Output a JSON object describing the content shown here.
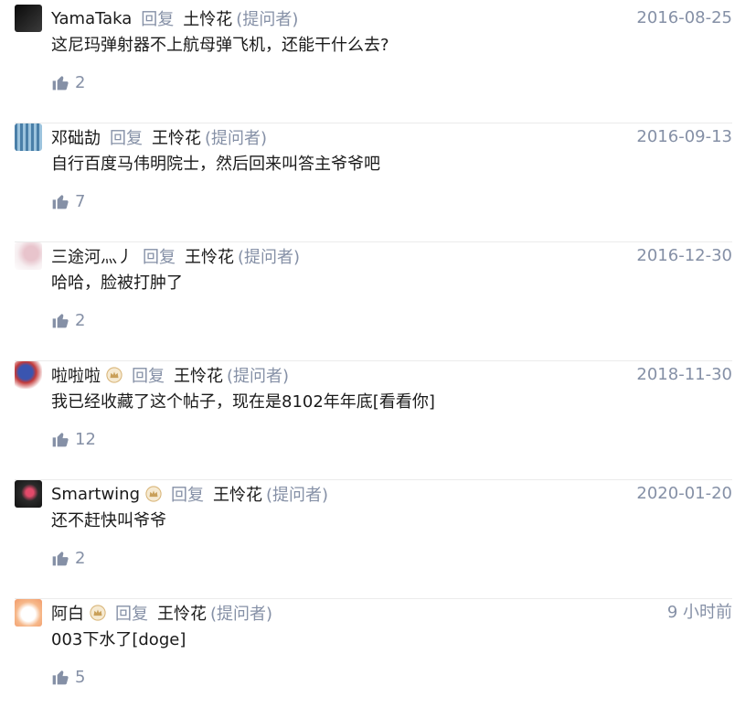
{
  "reply_label": "回复",
  "asker_label": "(提问者)",
  "icons": {
    "like": "thumbs-up-icon",
    "badge": "crown-badge-icon"
  },
  "comments": [
    {
      "username": "YamaTaka",
      "target": "土怜花",
      "date": "2016-08-25",
      "content": "这尼玛弹射器不上航母弹飞机，还能干什么去?",
      "likes": "2",
      "badge": false
    },
    {
      "username": "邓础劼",
      "target": "王怜花",
      "date": "2016-09-13",
      "content": "自行百度马伟明院士，然后回来叫答主爷爷吧",
      "likes": "7",
      "badge": false
    },
    {
      "username": "三途河灬丿",
      "target": "王怜花",
      "date": "2016-12-30",
      "content": "哈哈，脸被打肿了",
      "likes": "2",
      "badge": false
    },
    {
      "username": "啦啦啦",
      "target": "王怜花",
      "date": "2018-11-30",
      "content": "我已经收藏了这个帖子，现在是8102年年底[看看你]",
      "likes": "12",
      "badge": true
    },
    {
      "username": "Smartwing",
      "target": "王怜花",
      "date": "2020-01-20",
      "content": "还不赶快叫爷爷",
      "likes": "2",
      "badge": true
    },
    {
      "username": "阿白",
      "target": "王怜花",
      "date": "9 小时前",
      "content": "003下水了[doge]",
      "likes": "5",
      "badge": true
    }
  ]
}
